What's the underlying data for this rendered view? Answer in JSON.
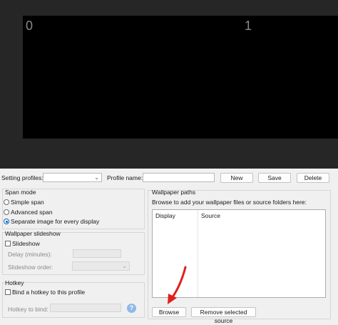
{
  "preview": {
    "display_labels": [
      "0",
      "1"
    ]
  },
  "profiles": {
    "setting_profiles_label": "Setting profiles:",
    "profile_name_label": "Profile name:",
    "new_label": "New",
    "save_label": "Save",
    "delete_label": "Delete",
    "profile_name_value": ""
  },
  "span_mode": {
    "title": "Span mode",
    "options": [
      "Simple span",
      "Advanced span",
      "Separate image for every display"
    ],
    "selected": "Separate image for every display"
  },
  "slideshow": {
    "title": "Wallpaper slideshow",
    "checkbox_label": "Slideshow",
    "checked": false,
    "delay_label": "Delay (minutes):",
    "order_label": "Slideshow order:"
  },
  "hotkey": {
    "title": "Hotkey",
    "checkbox_label": "Bind a hotkey to this profile",
    "checked": false,
    "bind_label": "Hotkey to bind:",
    "help_label": "?"
  },
  "wallpaper_paths": {
    "title": "Wallpaper paths",
    "hint": "Browse to add your wallpaper files or source folders here:",
    "columns": [
      "Display",
      "Source"
    ],
    "browse_label": "Browse",
    "remove_label": "Remove selected source"
  },
  "colors": {
    "accent": "#005fb8",
    "annotation_arrow": "#e0201b"
  },
  "icons": {
    "dropdown": "chevron-down-icon",
    "help": "help-icon",
    "annotation": "red-arrow-annotation"
  }
}
